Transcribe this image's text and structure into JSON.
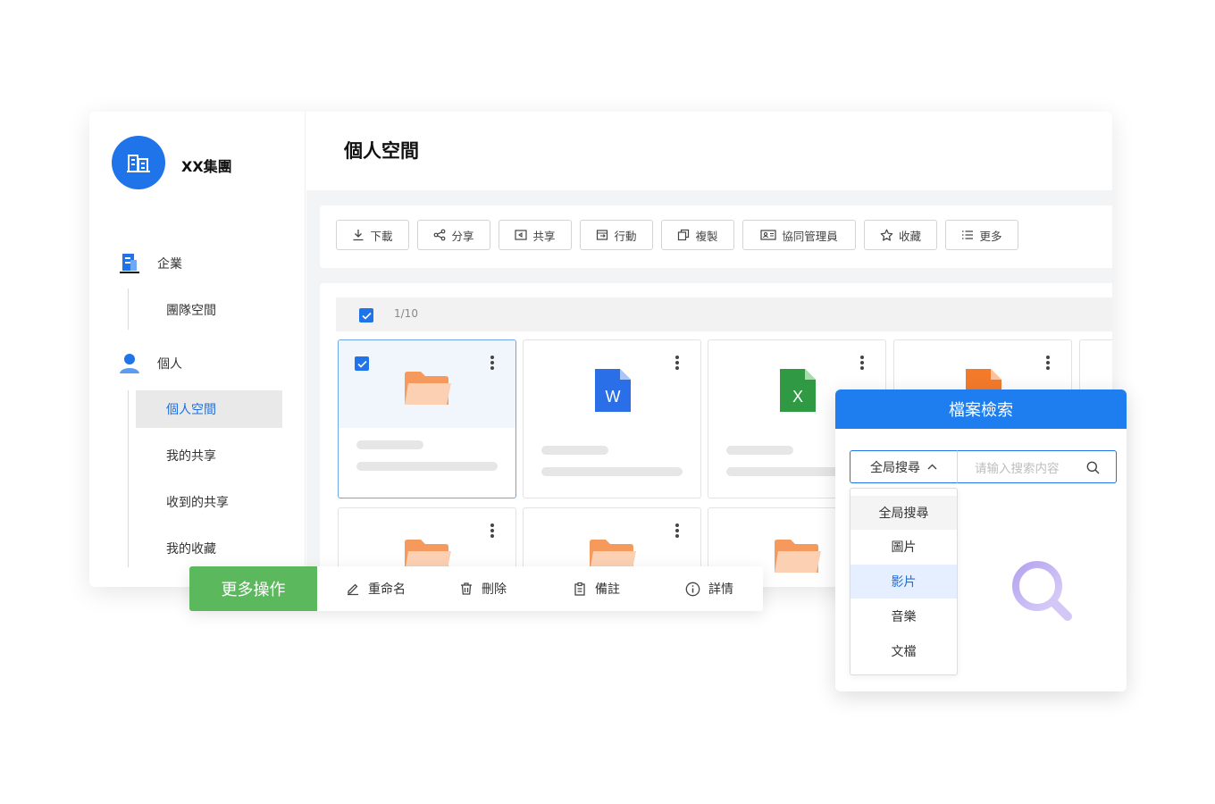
{
  "org": {
    "name": "XX集團"
  },
  "sidebar": {
    "groups": [
      {
        "label": "企業",
        "icon": "enterprise-building-icon",
        "items": [
          {
            "label": "團隊空間"
          }
        ]
      },
      {
        "label": "個人",
        "icon": "person-icon",
        "items": [
          {
            "label": "個人空間",
            "active": true
          },
          {
            "label": "我的共享"
          },
          {
            "label": "收到的共享"
          },
          {
            "label": "我的收藏"
          }
        ]
      }
    ]
  },
  "main": {
    "title": "個人空間",
    "toolbar": [
      {
        "label": "下載",
        "icon": "download-icon"
      },
      {
        "label": "分享",
        "icon": "share-icon"
      },
      {
        "label": "共享",
        "icon": "shared-folder-icon"
      },
      {
        "label": "行動",
        "icon": "move-icon"
      },
      {
        "label": "複製",
        "icon": "copy-icon"
      },
      {
        "label": "協同管理員",
        "icon": "collaborator-card-icon"
      },
      {
        "label": "收藏",
        "icon": "star-icon"
      },
      {
        "label": "更多",
        "icon": "list-icon"
      }
    ],
    "selection_count": "1/10",
    "files": [
      {
        "type": "folder",
        "selected": true
      },
      {
        "type": "word",
        "badge": "W"
      },
      {
        "type": "excel",
        "badge": "X"
      },
      {
        "type": "ppt"
      },
      {
        "type": "folder"
      },
      {
        "type": "folder"
      },
      {
        "type": "folder"
      }
    ]
  },
  "actionbar": {
    "title": "更多操作",
    "actions": [
      {
        "label": "重命名",
        "icon": "edit-icon"
      },
      {
        "label": "刪除",
        "icon": "trash-icon"
      },
      {
        "label": "備註",
        "icon": "clipboard-icon"
      },
      {
        "label": "詳情",
        "icon": "info-icon"
      }
    ]
  },
  "search": {
    "title": "檔案檢索",
    "scope_value": "全局搜尋",
    "placeholder": "请输入搜索内容",
    "options": [
      "全局搜尋",
      "圖片",
      "影片",
      "音樂",
      "文檔"
    ],
    "active_option": "影片"
  },
  "colors": {
    "primary": "#1e74e8",
    "green": "#5cb85c",
    "folder": "#f7a26a"
  }
}
